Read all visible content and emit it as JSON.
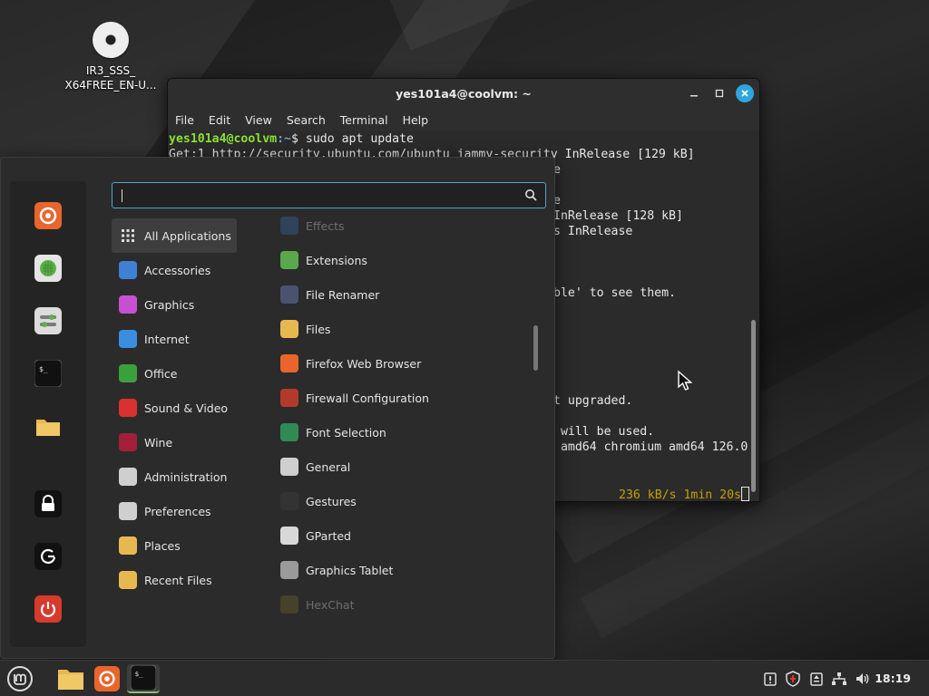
{
  "desktop": {
    "icons": [
      {
        "label_line1": "IR3_SSS_",
        "label_line2": "X64FREE_EN-U...",
        "icon": "disc-icon"
      }
    ]
  },
  "terminal": {
    "title": "yes101a4@coolvm: ~",
    "menu": [
      "File",
      "Edit",
      "View",
      "Search",
      "Terminal",
      "Help"
    ],
    "prompt_user": "yes101a4@coolvm",
    "prompt_path": ":~",
    "prompt_symbol": "$ ",
    "command": "sudo apt update",
    "lines": [
      "Get:1 http://security.ubuntu.com/ubuntu jammy-security InRelease [129 kB]",
      "e",
      "",
      "e",
      "InRelease [128 kB]",
      "s InRelease",
      "",
      "",
      "",
      "ble' to see them.",
      "",
      "",
      "",
      "",
      "",
      "",
      "t upgraded.",
      "",
      " will be used.",
      " amd64 chromium amd64 126.0",
      "",
      ""
    ],
    "progress_text": "236 kB/s 1min 20s"
  },
  "menu": {
    "search_placeholder": "",
    "favorites": [
      {
        "name": "firefox-icon",
        "color": "#e8662d"
      },
      {
        "name": "software-manager-icon",
        "color": "#5fb04b"
      },
      {
        "name": "settings-icon",
        "color": "#d9d9d9"
      },
      {
        "name": "terminal-icon",
        "color": "#1e1e1e"
      },
      {
        "name": "folder-icon",
        "color": "#e8b850"
      },
      {
        "name": "lock-screen-icon",
        "color": "#1a1a1a"
      },
      {
        "name": "logout-icon",
        "color": "#1a1a1a"
      },
      {
        "name": "shutdown-icon",
        "color": "#d63a2e"
      }
    ],
    "categories": [
      {
        "label": "All Applications",
        "icon": "grid-icon",
        "color": "#4a4a4a",
        "active": true
      },
      {
        "label": "Accessories",
        "icon": "scissors-icon",
        "color": "#3f7fd4"
      },
      {
        "label": "Graphics",
        "icon": "graphics-icon",
        "color": "#c94fd1"
      },
      {
        "label": "Internet",
        "icon": "cloud-icon",
        "color": "#3a8de0"
      },
      {
        "label": "Office",
        "icon": "office-icon",
        "color": "#3aa13a"
      },
      {
        "label": "Sound & Video",
        "icon": "play-icon",
        "color": "#d8322e"
      },
      {
        "label": "Wine",
        "icon": "wine-icon",
        "color": "#a3203a"
      },
      {
        "label": "Administration",
        "icon": "admin-icon",
        "color": "#cfcfcf"
      },
      {
        "label": "Preferences",
        "icon": "preferences-icon",
        "color": "#cfcfcf"
      },
      {
        "label": "Places",
        "icon": "folder-icon",
        "color": "#e8b850"
      },
      {
        "label": "Recent Files",
        "icon": "recent-files-icon",
        "color": "#e8b850"
      }
    ],
    "apps": [
      {
        "label": "Effects",
        "icon": "effects-icon",
        "color": "#3d6fb0",
        "faded": true
      },
      {
        "label": "Extensions",
        "icon": "puzzle-icon",
        "color": "#5aa84a"
      },
      {
        "label": "File Renamer",
        "icon": "file-renamer-icon",
        "color": "#4a5270"
      },
      {
        "label": "Files",
        "icon": "folder-icon",
        "color": "#e8b850"
      },
      {
        "label": "Firefox Web Browser",
        "icon": "firefox-icon",
        "color": "#e8662d"
      },
      {
        "label": "Firewall Configuration",
        "icon": "firewall-icon",
        "color": "#b33a2a"
      },
      {
        "label": "Font Selection",
        "icon": "font-icon",
        "color": "#2f8a55"
      },
      {
        "label": "General",
        "icon": "general-icon",
        "color": "#cfcfcf"
      },
      {
        "label": "Gestures",
        "icon": "hand-pointer-icon",
        "color": "#333333"
      },
      {
        "label": "GParted",
        "icon": "gparted-icon",
        "color": "#d8d8d8"
      },
      {
        "label": "Graphics Tablet",
        "icon": "tablet-icon",
        "color": "#9a9a9a"
      },
      {
        "label": "HexChat",
        "icon": "hexchat-icon",
        "color": "#7a6a2a",
        "faded": true
      }
    ]
  },
  "taskbar": {
    "clock": "18:19",
    "items": [
      "mint-menu-icon",
      "files-icon",
      "firefox-icon",
      "terminal-icon"
    ],
    "tray": [
      "update-manager-icon",
      "shield-icon",
      "clipboard-icon",
      "network-icon",
      "volume-icon"
    ]
  }
}
